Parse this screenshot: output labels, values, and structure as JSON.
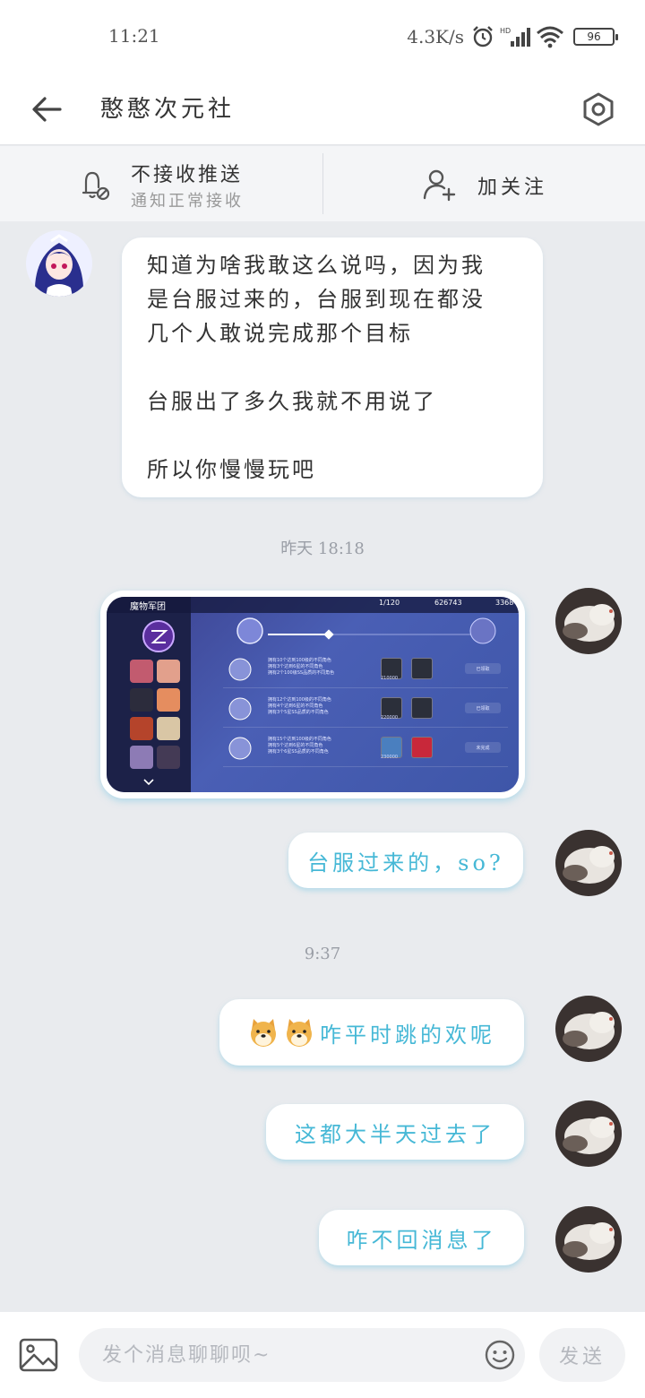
{
  "status_bar": {
    "time": "11:21",
    "net_speed": "4.3K/s",
    "battery": "96"
  },
  "header": {
    "title": "憨憨次元社"
  },
  "subbar": {
    "push_title": "不接收推送",
    "push_subtitle": "通知正常接收",
    "follow_label": "加关注"
  },
  "messages": {
    "incoming_text": "知道为啥我敢这么说吗，因为我\n是台服过来的，台服到现在都没\n几个人敢说完成那个目标\n\n台服出了多久我就不用说了\n\n所以你慢慢玩吧",
    "timestamp_1": "昨天 18:18",
    "out_1": "台服过来的，so?",
    "timestamp_2": "9:37",
    "out_2": "咋平时跳的欢呢",
    "out_3": "这都大半天过去了",
    "out_4": "咋不回消息了"
  },
  "screenshot": {
    "title": "魔物军团",
    "resource_1": "1/120",
    "resource_2": "626743",
    "resource_3": "3368",
    "rows": [
      {
        "lines": [
          "拥有10个达到100级的不同角色",
          "拥有3个达到6星的不同角色",
          "拥有2个100级SS品质的不同角色"
        ],
        "item_value": "210000",
        "status": "已领取"
      },
      {
        "lines": [
          "拥有12个达到100级的不同角色",
          "拥有4个达到6星的不同角色",
          "拥有3个5星SS品质的不同角色"
        ],
        "item_value": "220000",
        "status": "已领取"
      },
      {
        "lines": [
          "拥有15个达到100级的不同角色",
          "拥有5个达到6星的不同角色",
          "拥有3个6星SS品质的不同角色"
        ],
        "item_value": "230000",
        "status": "未完成"
      }
    ]
  },
  "input": {
    "placeholder": "发个消息聊聊呗~",
    "send_label": "发送"
  },
  "colors": {
    "accent": "#46b8d6",
    "background": "#e9ebee"
  }
}
